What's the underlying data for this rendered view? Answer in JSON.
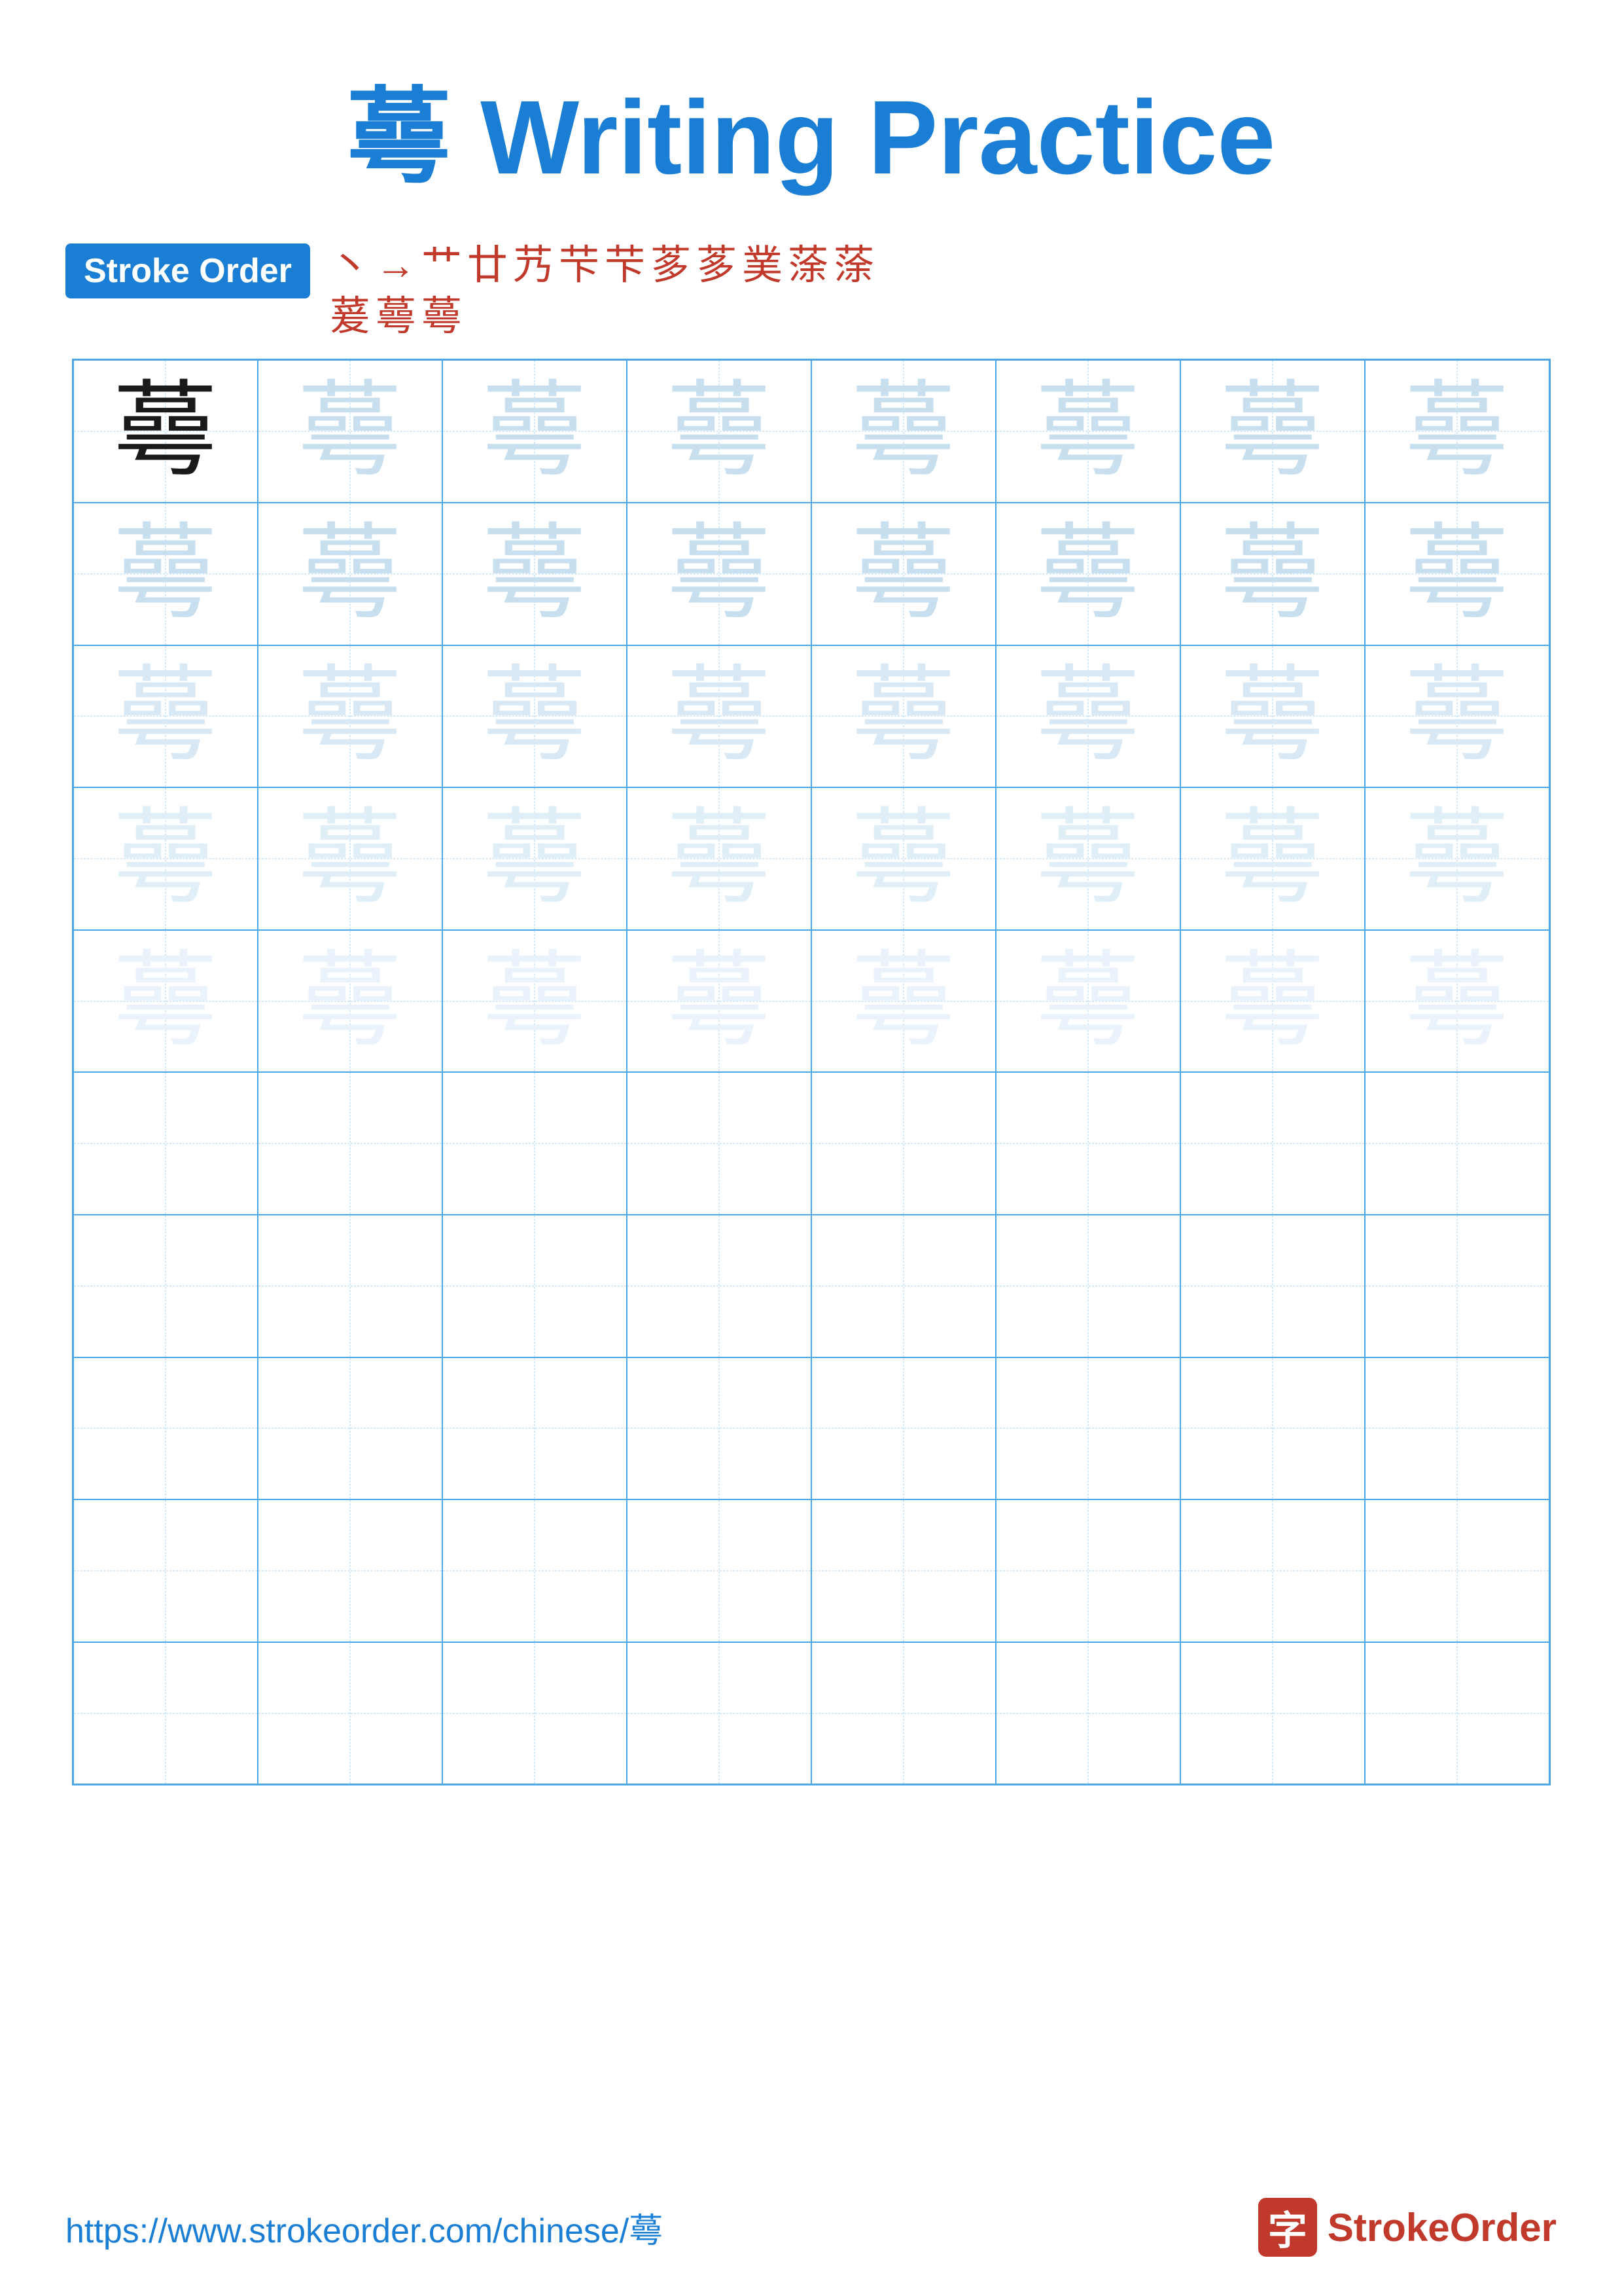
{
  "title": {
    "char": "蕚",
    "label": "Writing Practice",
    "full": "蕚 Writing Practice"
  },
  "stroke_order": {
    "badge_label": "Stroke Order",
    "sequence_row1": [
      "丶",
      "→",
      "艹",
      "廿",
      "艿",
      "芐",
      "芐",
      "茤",
      "茤",
      "菐",
      "蒤",
      "蒤"
    ],
    "sequence_row2": [
      "萲",
      "蕚",
      "蕚"
    ]
  },
  "grid": {
    "char": "蕚",
    "rows": 10,
    "cols": 8,
    "opacity_levels": [
      "dark",
      "light1",
      "light1",
      "light2",
      "light2",
      "light3",
      "light3",
      "light4",
      "light4",
      "empty"
    ]
  },
  "footer": {
    "url": "https://www.strokeorder.com/chinese/蕚",
    "logo_char": "字",
    "logo_text_part1": "Stroke",
    "logo_text_part2": "Order"
  }
}
